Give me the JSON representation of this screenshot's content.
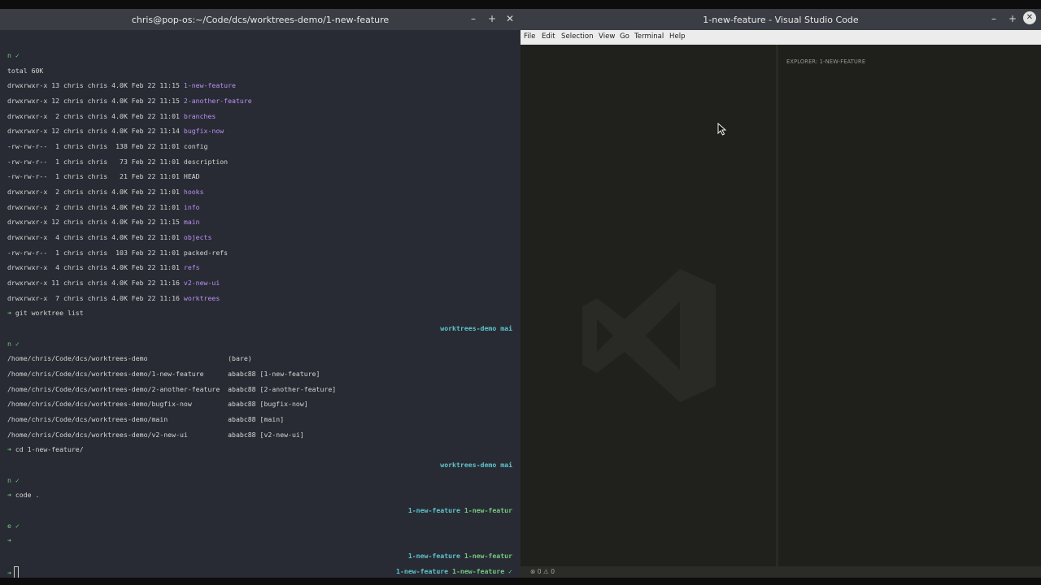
{
  "terminal": {
    "title": "chris@pop-os:~/Code/dcs/worktrees-demo/1-new-feature",
    "controls": {
      "minimize": "–",
      "maximize": "+",
      "close": "✕"
    },
    "lines": [
      [
        {
          "t": "n ✓",
          "c": "c-prompt"
        }
      ],
      [
        {
          "t": "total 60K"
        }
      ],
      [
        {
          "t": "drwxrwxr-x 13 chris chris 4.0K Feb 22 11:15 "
        },
        {
          "t": "1-new-feature",
          "c": "c-dir"
        }
      ],
      [
        {
          "t": "drwxrwxr-x 12 chris chris 4.0K Feb 22 11:15 "
        },
        {
          "t": "2-another-feature",
          "c": "c-dir"
        }
      ],
      [
        {
          "t": "drwxrwxr-x  2 chris chris 4.0K Feb 22 11:01 "
        },
        {
          "t": "branches",
          "c": "c-dir"
        }
      ],
      [
        {
          "t": "drwxrwxr-x 12 chris chris 4.0K Feb 22 11:14 "
        },
        {
          "t": "bugfix-now",
          "c": "c-dir"
        }
      ],
      [
        {
          "t": "-rw-rw-r--  1 chris chris  138 Feb 22 11:01 config"
        }
      ],
      [
        {
          "t": "-rw-rw-r--  1 chris chris   73 Feb 22 11:01 description"
        }
      ],
      [
        {
          "t": "-rw-rw-r--  1 chris chris   21 Feb 22 11:01 HEAD"
        }
      ],
      [
        {
          "t": "drwxrwxr-x  2 chris chris 4.0K Feb 22 11:01 "
        },
        {
          "t": "hooks",
          "c": "c-dir"
        }
      ],
      [
        {
          "t": "drwxrwxr-x  2 chris chris 4.0K Feb 22 11:01 "
        },
        {
          "t": "info",
          "c": "c-dir"
        }
      ],
      [
        {
          "t": "drwxrwxr-x 12 chris chris 4.0K Feb 22 11:15 "
        },
        {
          "t": "main",
          "c": "c-dir"
        }
      ],
      [
        {
          "t": "drwxrwxr-x  4 chris chris 4.0K Feb 22 11:01 "
        },
        {
          "t": "objects",
          "c": "c-dir"
        }
      ],
      [
        {
          "t": "-rw-rw-r--  1 chris chris  103 Feb 22 11:01 packed-refs"
        }
      ],
      [
        {
          "t": "drwxrwxr-x  4 chris chris 4.0K Feb 22 11:01 "
        },
        {
          "t": "refs",
          "c": "c-dir"
        }
      ],
      [
        {
          "t": "drwxrwxr-x 11 chris chris 4.0K Feb 22 11:16 "
        },
        {
          "t": "v2-new-ui",
          "c": "c-dir"
        }
      ],
      [
        {
          "t": "drwxrwxr-x  7 chris chris 4.0K Feb 22 11:16 "
        },
        {
          "t": "worktrees",
          "c": "c-dir"
        }
      ],
      [
        {
          "t": "➜ ",
          "c": "c-prompt"
        },
        {
          "t": "git worktree list"
        }
      ],
      [],
      [
        {
          "t": "n ✓",
          "c": "c-prompt"
        }
      ],
      [
        {
          "t": "/home/chris/Code/dcs/worktrees-demo                    (bare)"
        }
      ],
      [
        {
          "t": "/home/chris/Code/dcs/worktrees-demo/1-new-feature      ababc88 [1-new-feature]"
        }
      ],
      [
        {
          "t": "/home/chris/Code/dcs/worktrees-demo/2-another-feature  ababc88 [2-another-feature]"
        }
      ],
      [
        {
          "t": "/home/chris/Code/dcs/worktrees-demo/bugfix-now         ababc88 [bugfix-now]"
        }
      ],
      [
        {
          "t": "/home/chris/Code/dcs/worktrees-demo/main               ababc88 [main]"
        }
      ],
      [
        {
          "t": "/home/chris/Code/dcs/worktrees-demo/v2-new-ui          ababc88 [v2-new-ui]"
        }
      ],
      [
        {
          "t": "➜ ",
          "c": "c-prompt"
        },
        {
          "t": "cd 1-new-feature/"
        }
      ],
      [],
      [
        {
          "t": "n ✓",
          "c": "c-prompt"
        }
      ],
      [
        {
          "t": "➜ ",
          "c": "c-prompt"
        },
        {
          "t": "code ."
        }
      ],
      [],
      [
        {
          "t": "e ✓",
          "c": "c-prompt"
        }
      ],
      [
        {
          "t": "➜",
          "c": "c-prompt"
        }
      ],
      [],
      [
        {
          "t": "➜",
          "c": "c-prompt"
        }
      ]
    ],
    "right_prompts": [
      {
        "line": 18,
        "parts": [
          {
            "t": "worktrees-demo mai",
            "c": "c-teal"
          }
        ]
      },
      {
        "line": 27,
        "parts": [
          {
            "t": "worktrees-demo mai",
            "c": "c-teal"
          }
        ]
      },
      {
        "line": 30,
        "parts": [
          {
            "t": "1-new-feature ",
            "c": "c-teal"
          },
          {
            "t": "1-new-featur",
            "c": "c-green"
          }
        ]
      },
      {
        "line": 33,
        "parts": [
          {
            "t": "1-new-feature ",
            "c": "c-teal"
          },
          {
            "t": "1-new-featur",
            "c": "c-green"
          }
        ]
      },
      {
        "line": 34,
        "parts": [
          {
            "t": "1-new-feature ",
            "c": "c-teal"
          },
          {
            "t": "1-new-feature ✓",
            "c": "c-green"
          }
        ]
      }
    ]
  },
  "vscode": {
    "title": "1-new-feature - Visual Studio Code",
    "controls": {
      "minimize": "–",
      "maximize": "+",
      "close": "✕"
    },
    "menu": [
      "File",
      "Edit",
      "Selection",
      "View",
      "Go",
      "Terminal",
      "Help"
    ],
    "explorer_title": "EXPLORER: 1-NEW-FEATURE",
    "status": "⊗ 0  ⚠ 0"
  }
}
